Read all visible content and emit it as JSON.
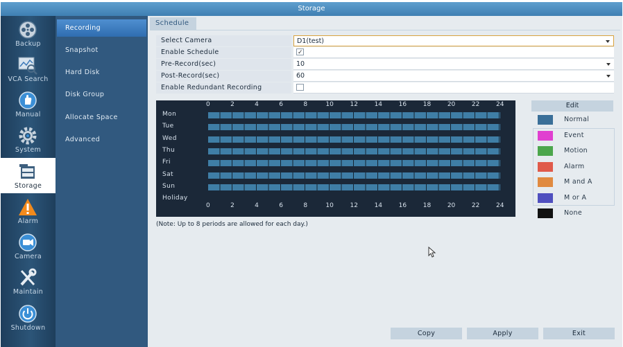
{
  "window": {
    "title": "Storage"
  },
  "rail": [
    {
      "id": "backup",
      "label": "Backup",
      "icon": "backup-reel-icon"
    },
    {
      "id": "vca",
      "label": "VCA Search",
      "icon": "vca-search-icon"
    },
    {
      "id": "manual",
      "label": "Manual",
      "icon": "manual-hand-icon"
    },
    {
      "id": "system",
      "label": "System",
      "icon": "gear-icon"
    },
    {
      "id": "storage",
      "label": "Storage",
      "icon": "storage-drive-icon",
      "active": true
    },
    {
      "id": "alarm",
      "label": "Alarm",
      "icon": "alarm-warning-icon"
    },
    {
      "id": "camera",
      "label": "Camera",
      "icon": "camera-icon"
    },
    {
      "id": "maintain",
      "label": "Maintain",
      "icon": "wrench-screwdriver-icon"
    },
    {
      "id": "shutdown",
      "label": "Shutdown",
      "icon": "power-icon"
    }
  ],
  "submenu": [
    {
      "label": "Recording",
      "active": true
    },
    {
      "label": "Snapshot"
    },
    {
      "label": "Hard Disk"
    },
    {
      "label": "Disk Group"
    },
    {
      "label": "Allocate Space"
    },
    {
      "label": "Advanced"
    }
  ],
  "tabs": {
    "schedule": "Schedule"
  },
  "form": {
    "select_camera": {
      "label": "Select Camera",
      "value": "D1(test)"
    },
    "enable_schedule": {
      "label": "Enable Schedule",
      "checked": true
    },
    "pre_record": {
      "label": "Pre-Record(sec)",
      "value": "10"
    },
    "post_record": {
      "label": "Post-Record(sec)",
      "value": "60"
    },
    "redundant": {
      "label": "Enable Redundant Recording",
      "checked": false
    }
  },
  "schedule": {
    "hours": [
      "0",
      "2",
      "4",
      "6",
      "8",
      "10",
      "12",
      "14",
      "16",
      "18",
      "20",
      "22",
      "24"
    ],
    "days": [
      "Mon",
      "Tue",
      "Wed",
      "Thu",
      "Fri",
      "Sat",
      "Sun",
      "Holiday"
    ],
    "note": "(Note: Up to 8 periods are allowed for each day.)"
  },
  "legend": {
    "edit_label": "Edit",
    "items": [
      {
        "label": "Normal",
        "color": "#3a6f98"
      },
      {
        "label": "Event",
        "color": "#e03fd0"
      },
      {
        "label": "Motion",
        "color": "#4ca64c"
      },
      {
        "label": "Alarm",
        "color": "#e05a4a"
      },
      {
        "label": "M and A",
        "color": "#e08a40"
      },
      {
        "label": "M or A",
        "color": "#4f4fbf"
      },
      {
        "label": "None",
        "color": "#111111"
      }
    ]
  },
  "buttons": {
    "copy": "Copy",
    "apply": "Apply",
    "exit": "Exit"
  }
}
